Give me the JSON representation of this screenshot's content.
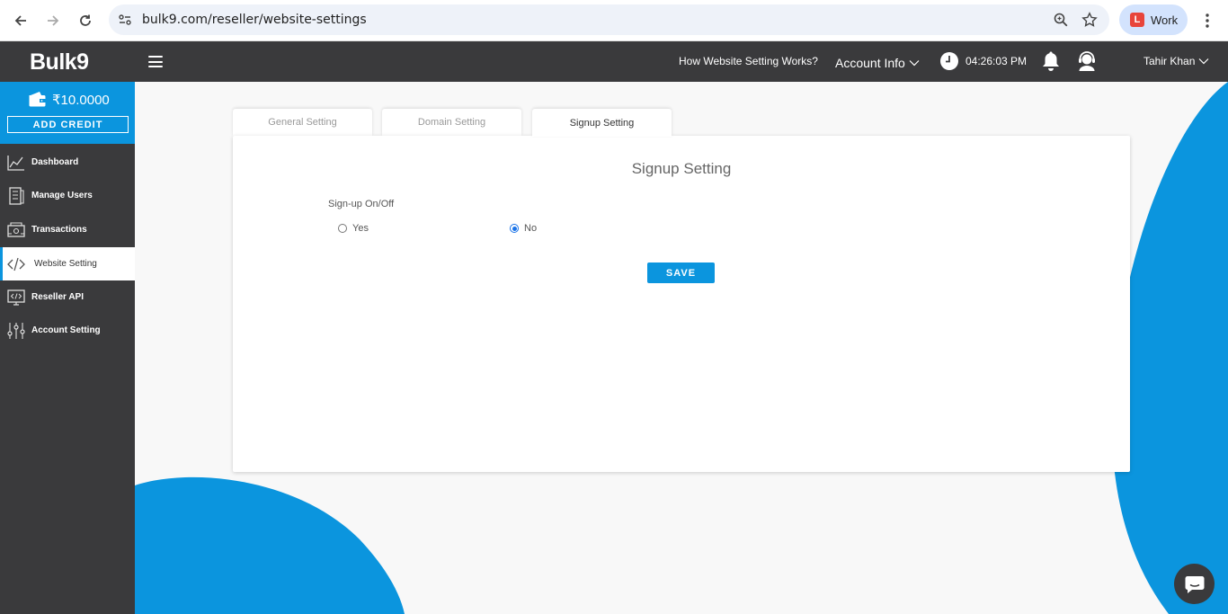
{
  "browser": {
    "url": "bulk9.com/reseller/website-settings",
    "profile_label": "Work",
    "profile_badge": "L"
  },
  "header": {
    "logo": "Bulk9",
    "help_link": "How Website Setting Works?",
    "account_info": "Account Info",
    "time": "04:26:03 PM",
    "user_name": "Tahir Khan"
  },
  "sidebar": {
    "balance": "₹10.0000",
    "add_credit": "ADD CREDIT",
    "items": [
      {
        "label": "Dashboard",
        "icon": "chart-icon"
      },
      {
        "label": "Manage Users",
        "icon": "users-icon"
      },
      {
        "label": "Transactions",
        "icon": "transactions-icon"
      },
      {
        "label": "Website Setting",
        "icon": "code-icon",
        "active": true
      },
      {
        "label": "Reseller API",
        "icon": "api-icon"
      },
      {
        "label": "Account Setting",
        "icon": "sliders-icon"
      }
    ]
  },
  "tabs": [
    {
      "label": "General Setting"
    },
    {
      "label": "Domain Setting"
    },
    {
      "label": "Signup Setting",
      "active": true
    }
  ],
  "form": {
    "title": "Signup Setting",
    "field_label": "Sign-up On/Off",
    "option_yes": "Yes",
    "option_no": "No",
    "selected": "No",
    "save_label": "SAVE"
  },
  "colors": {
    "accent": "#0b95de",
    "header_bg": "#3a3a3c"
  }
}
